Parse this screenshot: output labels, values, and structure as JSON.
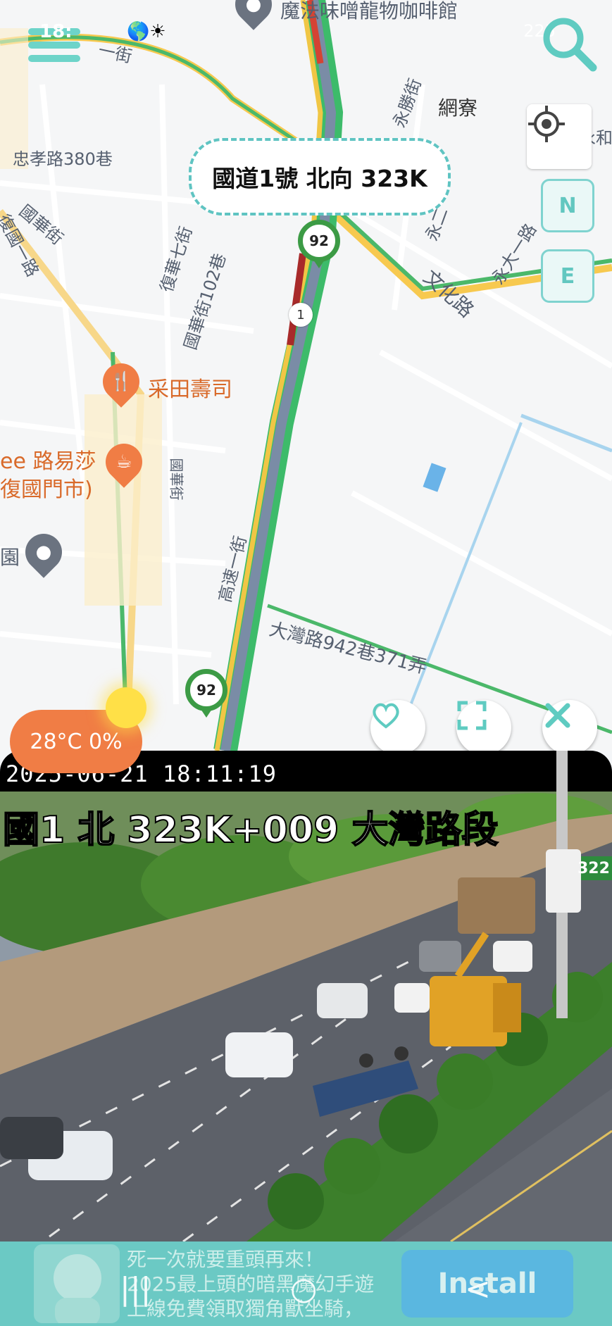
{
  "status_bar": {
    "time": "18:",
    "weather_icons": "🌎☀",
    "right_text": "225"
  },
  "map": {
    "callout": "國道1號 北向 323K",
    "route_badges": [
      "92",
      "92"
    ],
    "highway_marker": "1",
    "streets": {
      "top_street": "魔法味噌龍物咖啡館",
      "s1": "一街",
      "s2": "網寮",
      "s3": "忠孝路380巷",
      "s4": "國華街",
      "s5": "復國一路",
      "s6": "復華七街",
      "s7": "國華街102巷",
      "s8": "永勝街",
      "s9": "文化路",
      "s10": "永大一路",
      "s11": "永二",
      "s12": "高速一街",
      "s13": "大灣路942巷371弄",
      "s14": "永和",
      "s15": "國華街",
      "s16": "園"
    },
    "poi": {
      "restaurant": "采田壽司",
      "cafe_line1": "ee 路易莎",
      "cafe_line2": "復國門市)"
    },
    "controls": {
      "north": "N",
      "east": "E"
    },
    "weather": "28°C 0%"
  },
  "camera": {
    "timestamp": "2025-06-21 18:11:19",
    "location": "國1 北 323K+009 大灣路段",
    "sign_text": "322"
  },
  "ad": {
    "line1": "死一次就要重頭再來！",
    "line2": "2025最上頭的暗黑魔幻手遊",
    "line3": "上線免費領取獨角獸坐騎，",
    "install": "Install"
  },
  "nav": {
    "recent": "|||",
    "home": "○",
    "back": "<"
  },
  "colors": {
    "accent": "#62c7c0",
    "weather_bg": "#f07d45",
    "route_green": "#3c9b45"
  }
}
